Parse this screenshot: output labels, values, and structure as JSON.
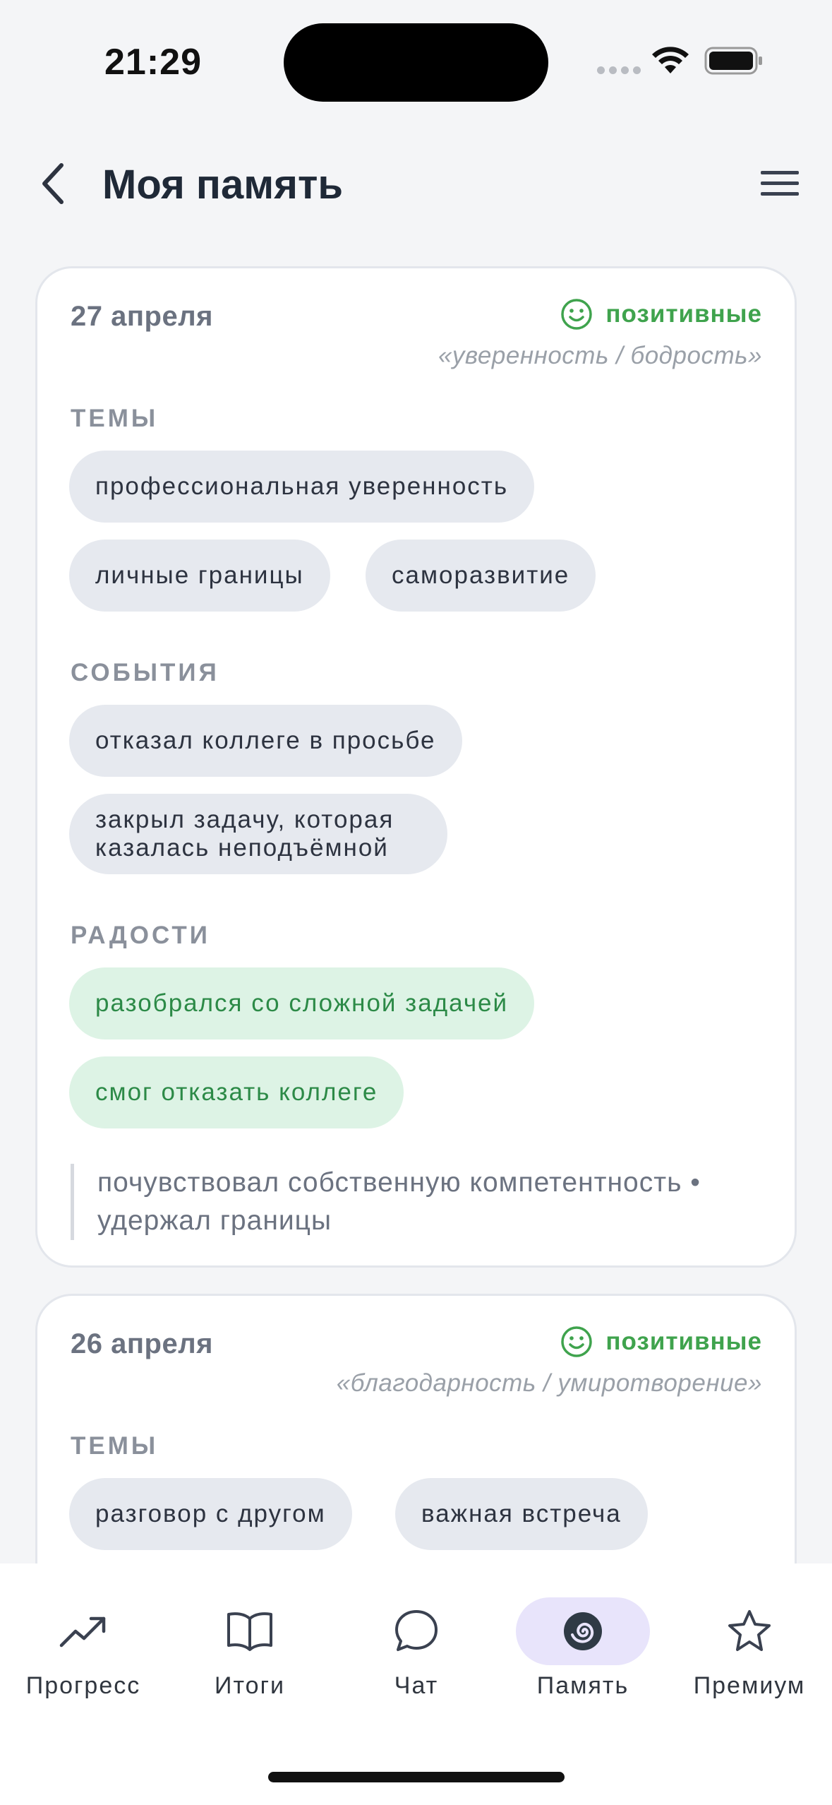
{
  "status_bar": {
    "time": "21:29"
  },
  "header": {
    "title": "Моя память"
  },
  "cards": [
    {
      "date": "27 апреля",
      "mood": "позитивные",
      "mood_quote": "«уверенность / бодрость»",
      "themes_label": "ТЕМЫ",
      "themes": [
        "профессиональная уверенность",
        "личные границы",
        "саморазвитие"
      ],
      "events_label": "СОБЫТИЯ",
      "events": [
        "отказал коллеге в просьбе",
        "закрыл задачу, которая казалась неподъёмной"
      ],
      "joys_label": "РАДОСТИ",
      "joys": [
        "разобрался со сложной задачей",
        "смог отказать коллеге"
      ],
      "note": "почувствовал собственную компетентность • удержал границы"
    },
    {
      "date": "26 апреля",
      "mood": "позитивные",
      "mood_quote": "«благодарность / умиротворение»",
      "themes_label": "ТЕМЫ",
      "themes": [
        "разговор с другом",
        "важная встреча"
      ]
    }
  ],
  "tab_bar": {
    "tabs": [
      {
        "label": "Прогресс",
        "icon": "trend-up-icon"
      },
      {
        "label": "Итоги",
        "icon": "book-icon"
      },
      {
        "label": "Чат",
        "icon": "chat-bubble-icon"
      },
      {
        "label": "Память",
        "icon": "spiral-icon"
      },
      {
        "label": "Премиум",
        "icon": "star-icon"
      }
    ],
    "active_index": 3
  },
  "colors": {
    "background": "#f4f5f7",
    "positive": "#3fa34d",
    "chip": "#e6e9ef",
    "joy_chip": "#ddf3e5",
    "active_tab": "#e8e4fb"
  }
}
